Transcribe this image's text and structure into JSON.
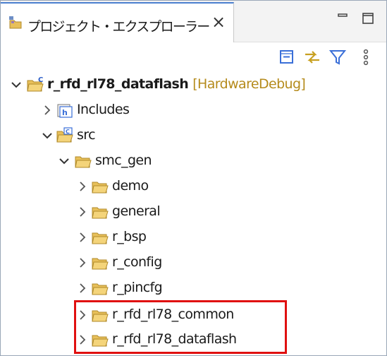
{
  "view": {
    "tab_title": "プロジェクト・エクスプローラー",
    "tab_close_glyph": "×"
  },
  "toolbar": {
    "items": [
      "collapse-all-icon",
      "link-with-editor-icon",
      "filter-icon",
      "view-menu-icon"
    ]
  },
  "tree": {
    "project": {
      "name": "r_rfd_rl78_dataflash",
      "config": "[HardwareDebug]"
    },
    "nodes": [
      {
        "label": "Includes",
        "expanded": false
      },
      {
        "label": "src",
        "expanded": true
      },
      {
        "label": "smc_gen",
        "expanded": true
      },
      {
        "label": "demo",
        "expanded": false
      },
      {
        "label": "general",
        "expanded": false
      },
      {
        "label": "r_bsp",
        "expanded": false
      },
      {
        "label": "r_config",
        "expanded": false
      },
      {
        "label": "r_pincfg",
        "expanded": false
      },
      {
        "label": "r_rfd_rl78_common",
        "expanded": false
      },
      {
        "label": "r_rfd_rl78_dataflash",
        "expanded": false
      }
    ]
  },
  "colors": {
    "highlight_box": "#e01010",
    "decoration_text": "#b58b1c",
    "folder": "#e8c05a",
    "accent": "#3a6fd8"
  }
}
